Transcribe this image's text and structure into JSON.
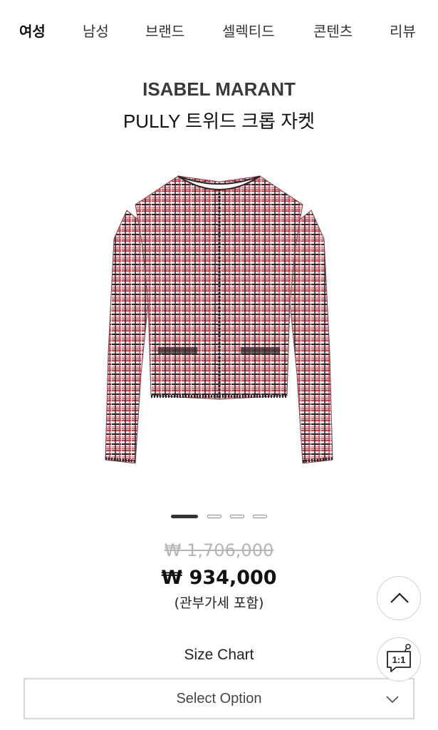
{
  "nav": {
    "items": [
      {
        "label": "여성",
        "active": true
      },
      {
        "label": "남성",
        "active": false
      },
      {
        "label": "브랜드",
        "active": false
      },
      {
        "label": "셀렉티드",
        "active": false
      },
      {
        "label": "콘텐츠",
        "active": false
      },
      {
        "label": "리뷰",
        "active": false
      }
    ]
  },
  "product": {
    "brand": "ISABEL MARANT",
    "name": "PULLY 트위드 크롭 자켓",
    "image": {
      "icon": "tweed-jacket-image"
    },
    "carousel": {
      "count": 4,
      "active_index": 0
    },
    "original_price": "₩ 1,706,000",
    "sale_price": "₩ 934,000",
    "tax_note": "(관부가세 포함)"
  },
  "size_chart": {
    "label": "Size Chart"
  },
  "option_select": {
    "label": "Select Option",
    "icon": "chevron-down-icon"
  },
  "floating": {
    "scroll_top": {
      "icon": "chevron-up-icon"
    },
    "chat": {
      "label": "1:1",
      "icon": "chat-bubble-icon"
    }
  },
  "colors": {
    "text": "#222222",
    "muted_price": "#b5b5b5",
    "border": "#d7d7d7",
    "tweed_red": "#d23a45",
    "tweed_pink": "#e98a9a",
    "tweed_black": "#2a2226"
  }
}
